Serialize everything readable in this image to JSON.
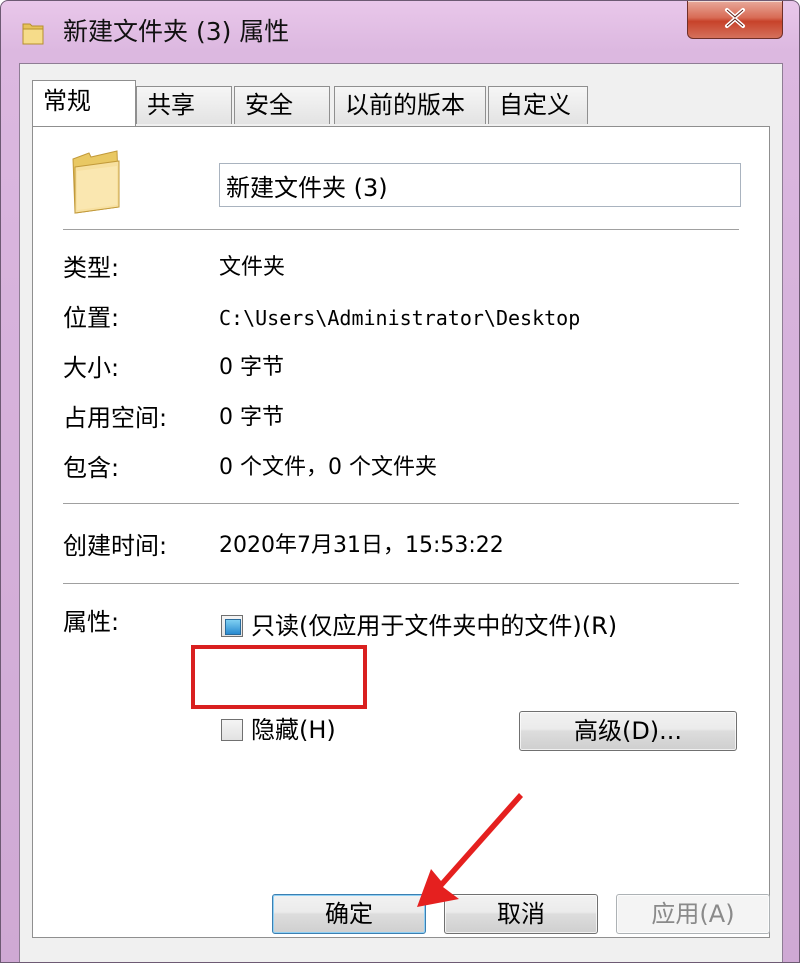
{
  "window": {
    "title": "新建文件夹 (3) 属性"
  },
  "tabs": [
    {
      "label": "常规",
      "active": true
    },
    {
      "label": "共享",
      "active": false
    },
    {
      "label": "安全",
      "active": false
    },
    {
      "label": "以前的版本",
      "active": false
    },
    {
      "label": "自定义",
      "active": false
    }
  ],
  "general": {
    "folder_name": "新建文件夹 (3)",
    "rows": {
      "type_label": "类型:",
      "type_value": "文件夹",
      "location_label": "位置:",
      "location_value": "C:\\Users\\Administrator\\Desktop",
      "size_label": "大小:",
      "size_value": "0 字节",
      "disk_label": "占用空间:",
      "disk_value": "0 字节",
      "contains_label": "包含:",
      "contains_value": "0 个文件，0 个文件夹",
      "created_label": "创建时间:",
      "created_value": "2020年7月31日，15:53:22"
    },
    "attributes": {
      "label": "属性:",
      "readonly_label": "只读(仅应用于文件夹中的文件)(R)",
      "readonly_state": "indeterminate",
      "hidden_label": "隐藏(H)",
      "hidden_checked": false,
      "advanced_label": "高级(D)..."
    }
  },
  "footer": {
    "ok_label": "确定",
    "cancel_label": "取消",
    "apply_label": "应用(A)",
    "apply_enabled": false
  },
  "colors": {
    "highlight": "#d9201f",
    "arrow": "#e5201f",
    "title_gradient": "#e9c7ea"
  },
  "icons": [
    "folder-icon",
    "close-icon",
    "pointer-arrow"
  ]
}
